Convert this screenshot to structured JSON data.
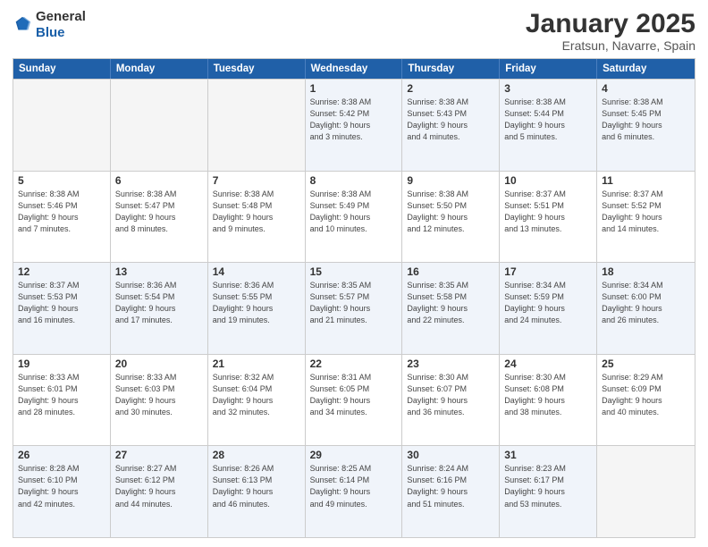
{
  "header": {
    "logo_general": "General",
    "logo_blue": "Blue",
    "title": "January 2025",
    "subtitle": "Eratsun, Navarre, Spain"
  },
  "calendar": {
    "days_of_week": [
      "Sunday",
      "Monday",
      "Tuesday",
      "Wednesday",
      "Thursday",
      "Friday",
      "Saturday"
    ],
    "weeks": [
      [
        {
          "day": "",
          "info": "",
          "empty": true
        },
        {
          "day": "",
          "info": "",
          "empty": true
        },
        {
          "day": "",
          "info": "",
          "empty": true
        },
        {
          "day": "1",
          "info": "Sunrise: 8:38 AM\nSunset: 5:42 PM\nDaylight: 9 hours\nand 3 minutes."
        },
        {
          "day": "2",
          "info": "Sunrise: 8:38 AM\nSunset: 5:43 PM\nDaylight: 9 hours\nand 4 minutes."
        },
        {
          "day": "3",
          "info": "Sunrise: 8:38 AM\nSunset: 5:44 PM\nDaylight: 9 hours\nand 5 minutes."
        },
        {
          "day": "4",
          "info": "Sunrise: 8:38 AM\nSunset: 5:45 PM\nDaylight: 9 hours\nand 6 minutes."
        }
      ],
      [
        {
          "day": "5",
          "info": "Sunrise: 8:38 AM\nSunset: 5:46 PM\nDaylight: 9 hours\nand 7 minutes."
        },
        {
          "day": "6",
          "info": "Sunrise: 8:38 AM\nSunset: 5:47 PM\nDaylight: 9 hours\nand 8 minutes."
        },
        {
          "day": "7",
          "info": "Sunrise: 8:38 AM\nSunset: 5:48 PM\nDaylight: 9 hours\nand 9 minutes."
        },
        {
          "day": "8",
          "info": "Sunrise: 8:38 AM\nSunset: 5:49 PM\nDaylight: 9 hours\nand 10 minutes."
        },
        {
          "day": "9",
          "info": "Sunrise: 8:38 AM\nSunset: 5:50 PM\nDaylight: 9 hours\nand 12 minutes."
        },
        {
          "day": "10",
          "info": "Sunrise: 8:37 AM\nSunset: 5:51 PM\nDaylight: 9 hours\nand 13 minutes."
        },
        {
          "day": "11",
          "info": "Sunrise: 8:37 AM\nSunset: 5:52 PM\nDaylight: 9 hours\nand 14 minutes."
        }
      ],
      [
        {
          "day": "12",
          "info": "Sunrise: 8:37 AM\nSunset: 5:53 PM\nDaylight: 9 hours\nand 16 minutes."
        },
        {
          "day": "13",
          "info": "Sunrise: 8:36 AM\nSunset: 5:54 PM\nDaylight: 9 hours\nand 17 minutes."
        },
        {
          "day": "14",
          "info": "Sunrise: 8:36 AM\nSunset: 5:55 PM\nDaylight: 9 hours\nand 19 minutes."
        },
        {
          "day": "15",
          "info": "Sunrise: 8:35 AM\nSunset: 5:57 PM\nDaylight: 9 hours\nand 21 minutes."
        },
        {
          "day": "16",
          "info": "Sunrise: 8:35 AM\nSunset: 5:58 PM\nDaylight: 9 hours\nand 22 minutes."
        },
        {
          "day": "17",
          "info": "Sunrise: 8:34 AM\nSunset: 5:59 PM\nDaylight: 9 hours\nand 24 minutes."
        },
        {
          "day": "18",
          "info": "Sunrise: 8:34 AM\nSunset: 6:00 PM\nDaylight: 9 hours\nand 26 minutes."
        }
      ],
      [
        {
          "day": "19",
          "info": "Sunrise: 8:33 AM\nSunset: 6:01 PM\nDaylight: 9 hours\nand 28 minutes."
        },
        {
          "day": "20",
          "info": "Sunrise: 8:33 AM\nSunset: 6:03 PM\nDaylight: 9 hours\nand 30 minutes."
        },
        {
          "day": "21",
          "info": "Sunrise: 8:32 AM\nSunset: 6:04 PM\nDaylight: 9 hours\nand 32 minutes."
        },
        {
          "day": "22",
          "info": "Sunrise: 8:31 AM\nSunset: 6:05 PM\nDaylight: 9 hours\nand 34 minutes."
        },
        {
          "day": "23",
          "info": "Sunrise: 8:30 AM\nSunset: 6:07 PM\nDaylight: 9 hours\nand 36 minutes."
        },
        {
          "day": "24",
          "info": "Sunrise: 8:30 AM\nSunset: 6:08 PM\nDaylight: 9 hours\nand 38 minutes."
        },
        {
          "day": "25",
          "info": "Sunrise: 8:29 AM\nSunset: 6:09 PM\nDaylight: 9 hours\nand 40 minutes."
        }
      ],
      [
        {
          "day": "26",
          "info": "Sunrise: 8:28 AM\nSunset: 6:10 PM\nDaylight: 9 hours\nand 42 minutes."
        },
        {
          "day": "27",
          "info": "Sunrise: 8:27 AM\nSunset: 6:12 PM\nDaylight: 9 hours\nand 44 minutes."
        },
        {
          "day": "28",
          "info": "Sunrise: 8:26 AM\nSunset: 6:13 PM\nDaylight: 9 hours\nand 46 minutes."
        },
        {
          "day": "29",
          "info": "Sunrise: 8:25 AM\nSunset: 6:14 PM\nDaylight: 9 hours\nand 49 minutes."
        },
        {
          "day": "30",
          "info": "Sunrise: 8:24 AM\nSunset: 6:16 PM\nDaylight: 9 hours\nand 51 minutes."
        },
        {
          "day": "31",
          "info": "Sunrise: 8:23 AM\nSunset: 6:17 PM\nDaylight: 9 hours\nand 53 minutes."
        },
        {
          "day": "",
          "info": "",
          "empty": true
        }
      ]
    ]
  }
}
